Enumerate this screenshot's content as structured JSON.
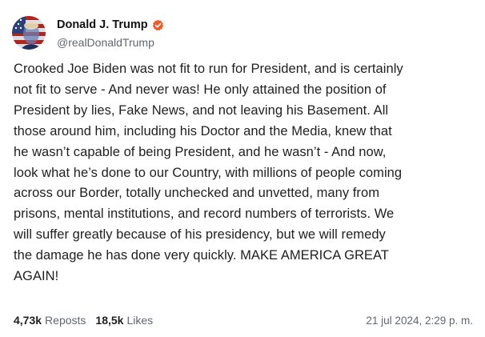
{
  "author": {
    "display_name": "Donald J. Trump",
    "handle": "@realDonaldTrump",
    "verified_icon": "verified-badge-icon",
    "verified_color": "#f05a2a"
  },
  "post": {
    "lines": [
      "Crooked Joe Biden was not fit to run for President, and is certainly",
      "not fit to serve - And never was! He only attained the position of",
      "President by lies, Fake News, and not leaving his Basement. All",
      "those around him, including his Doctor and the Media, knew that",
      "he wasn’t capable of being President, and he wasn’t - And now,",
      "look what he’s done to our Country, with millions of people coming",
      "across our Border, totally unchecked and unvetted, many from",
      "prisons, mental institutions, and record numbers of terrorists. We",
      "will suffer greatly because of his presidency, but we will remedy",
      "the damage he has done very quickly. MAKE AMERICA GREAT",
      "AGAIN!"
    ]
  },
  "stats": {
    "reposts_count": "4,73k",
    "reposts_label": "Reposts",
    "likes_count": "18,5k",
    "likes_label": "Likes"
  },
  "timestamp": "21 jul 2024, 2:29 p. m."
}
